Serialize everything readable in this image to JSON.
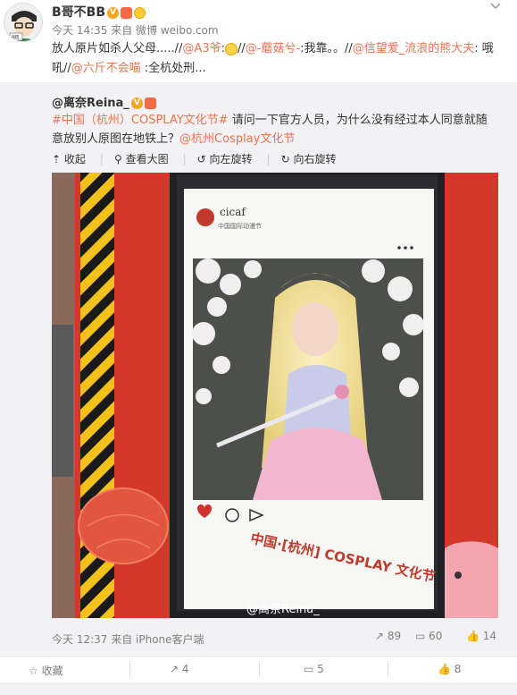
{
  "post": {
    "author": "B哥不BB",
    "meta": "今天 14:35 来自 微博 weibo.com",
    "text_1": "放人原片如杀人父母.....//",
    "mention_a3": "@A3爷",
    "text_2": ":",
    "text_3": "//",
    "mention_mogu": "@-蘑菇兮-",
    "text_4": ":我靠。。//",
    "mention_xinwang": "@信望爱_流浪的熊大夫",
    "text_5": ": 哦吼//",
    "mention_liujin": "@六斤不会喵",
    "text_6": " :全杭处刑..."
  },
  "repost": {
    "user": "@离奈Reina_",
    "hashtag": "#中国（杭州）COSPLAY文化节#",
    "text": " 请问一下官方人员，为什么没有经过本人同意就随意放别人原图在地铁上？",
    "mention": "@杭州Cosplay文化节",
    "tools": {
      "collapse": "收起",
      "view_large": "查看大图",
      "rotate_left": "向左旋转",
      "rotate_right": "向右旋转"
    },
    "photo": {
      "brand_logo_text": "cicaf",
      "brand_logo_cn": "中国国际动漫节",
      "banner": "中国·[杭州] COSPLAY 文化节",
      "watermark": "@离奈Reina_"
    },
    "meta": "今天 12:37 来自 iPhone客户端",
    "stats": {
      "reposts": "89",
      "comments": "60",
      "likes": "14"
    }
  },
  "actions": {
    "favorite": "收藏",
    "repost": "4",
    "comment": "5",
    "like": "8"
  },
  "colors": {
    "link": "#eb7350",
    "panel": "#f2f2f5",
    "subway_red": "#d3382b"
  }
}
